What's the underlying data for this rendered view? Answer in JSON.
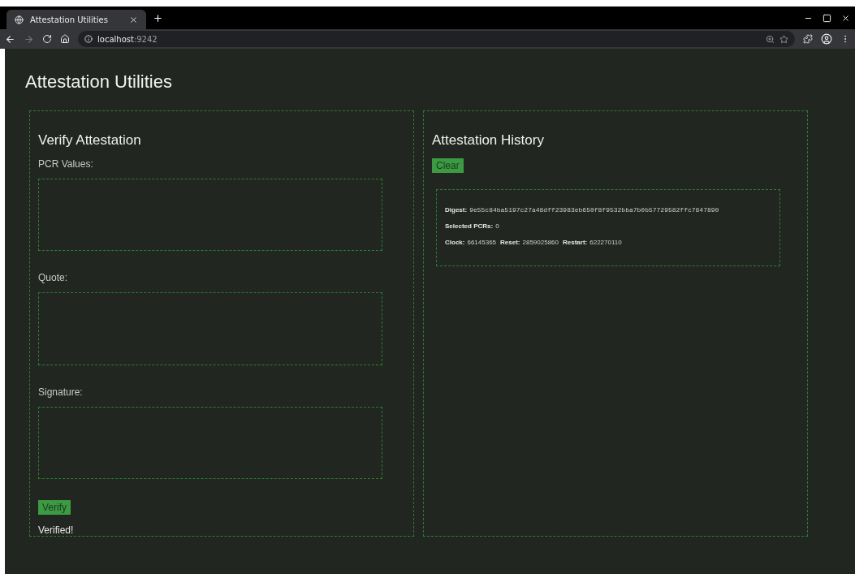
{
  "browser": {
    "tab_title": "Attestation Utilities",
    "url_host": "localhost",
    "url_port": ":9242"
  },
  "page_title": "Attestation Utilities",
  "verify_panel": {
    "title": "Verify Attestation",
    "fields": [
      {
        "label": "PCR Values:"
      },
      {
        "label": "Quote:"
      },
      {
        "label": "Signature:"
      }
    ],
    "button": "Verify",
    "status": "Verified!"
  },
  "history_panel": {
    "title": "Attestation History",
    "button": "Clear",
    "entries": [
      {
        "lines": [
          {
            "pairs": [
              {
                "label": "Digest:",
                "value": "9e55c84ba5197c27a48dff23983eb650f8f9532bba7b0b57729582ffc7847890",
                "kind": "mono"
              }
            ]
          },
          {
            "pairs": [
              {
                "label": "Selected PCRs:",
                "value": "0",
                "kind": "plain"
              }
            ]
          },
          {
            "pairs": [
              {
                "label": "Clock:",
                "value": "66145365",
                "kind": "plain"
              },
              {
                "label": "Reset:",
                "value": "2859025860",
                "kind": "plain"
              },
              {
                "label": "Restart:",
                "value": "622270110",
                "kind": "plain"
              }
            ]
          }
        ]
      }
    ]
  }
}
